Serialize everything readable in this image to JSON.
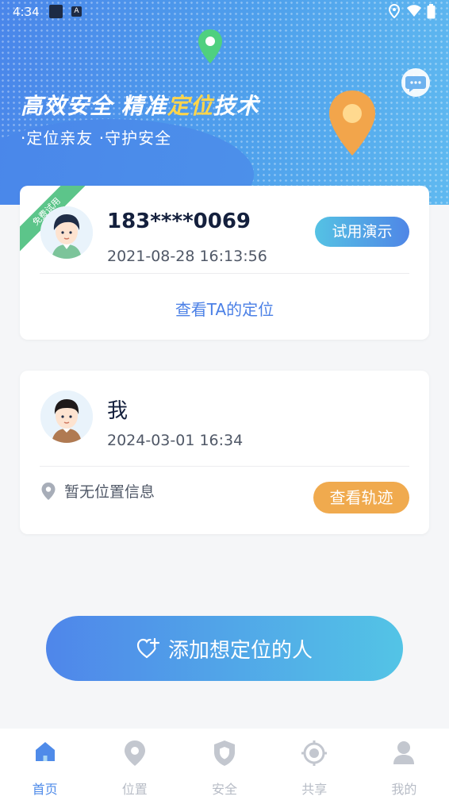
{
  "status_bar": {
    "time": "4:34",
    "app_badge": "A"
  },
  "banner": {
    "headline_part1": "高效安全 精准",
    "headline_highlight": "定位",
    "headline_part2": "技术",
    "subline": "·定位亲友  ·守护安全"
  },
  "trial_contact": {
    "ribbon": "免费试用",
    "phone": "183****0069",
    "timestamp": "2021-08-28 16:13:56",
    "demo_button": "试用演示",
    "view_location_link": "查看TA的定位"
  },
  "self_card": {
    "name": "我",
    "timestamp": "2024-03-01 16:34",
    "location_status": "暂无位置信息",
    "track_button": "查看轨迹"
  },
  "add_button": {
    "label": "添加想定位的人"
  },
  "bottom_nav": {
    "items": [
      {
        "label": "首页",
        "icon": "home-icon",
        "active": true
      },
      {
        "label": "位置",
        "icon": "location-pin-icon",
        "active": false
      },
      {
        "label": "安全",
        "icon": "shield-icon",
        "active": false
      },
      {
        "label": "共享",
        "icon": "target-icon",
        "active": false
      },
      {
        "label": "我的",
        "icon": "user-icon",
        "active": false
      }
    ]
  },
  "colors": {
    "primary_blue": "#4f86ea",
    "accent_orange": "#f0aa4e",
    "ribbon_green": "#5cc58a",
    "highlight_yellow": "#ffd54a"
  }
}
